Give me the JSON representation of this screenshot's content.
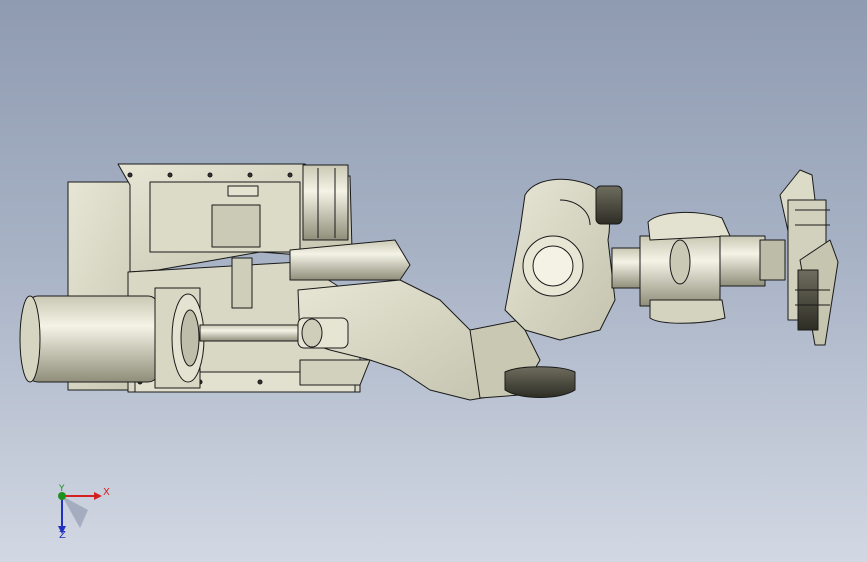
{
  "viewport": {
    "background_top": "#8f9bb1",
    "background_bottom": "#d2d8e3",
    "model_fill": "#e9e8d8",
    "model_shade": "#b8b7a2",
    "model_edge": "#1a1a1a"
  },
  "triad": {
    "x_label": "X",
    "y_label": "Y",
    "z_label": "Z",
    "x_color": "#d42020",
    "y_color": "#1f8f1f",
    "z_color": "#2030c0"
  }
}
